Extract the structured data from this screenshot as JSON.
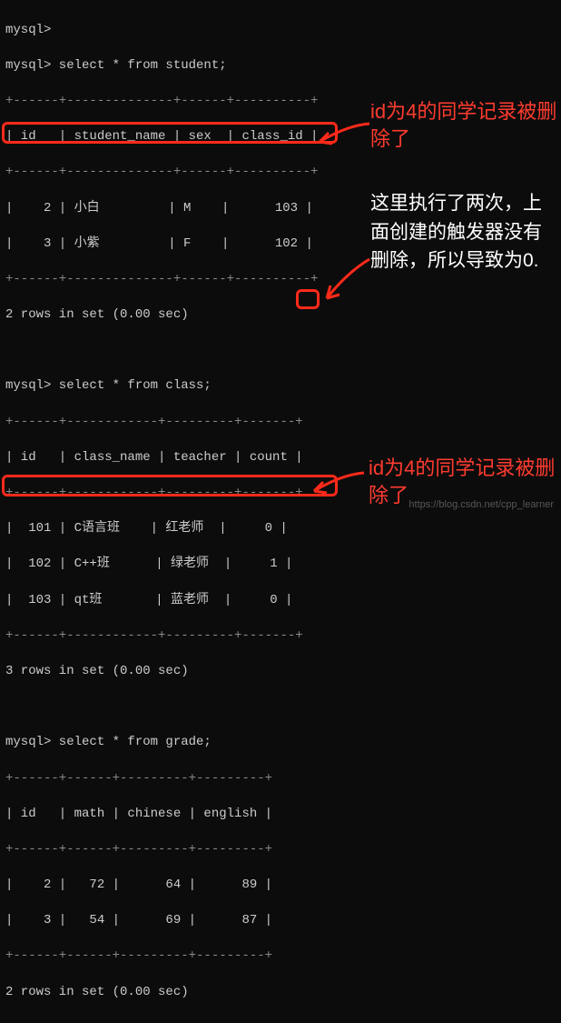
{
  "prompts": {
    "p0": "mysql>",
    "p1": "mysql> select * from student;",
    "p2": "mysql> select * from class;",
    "p3": "mysql> select * from grade;"
  },
  "student": {
    "sep": "+------+--------------+------+----------+",
    "header": "| id   | student_name | sex  | class_id |",
    "rows": [
      "|    2 | 小白         | M    |      103 |",
      "|    3 | 小紫         | F    |      102 |"
    ],
    "footer": "2 rows in set (0.00 sec)"
  },
  "class": {
    "sep": "+------+------------+---------+-------+",
    "header": "| id   | class_name | teacher | count |",
    "rows": [
      "|  101 | C语言班    | 红老师  |     0 |",
      "|  102 | C++班      | 绿老师  |     1 |",
      "|  103 | qt班       | 蓝老师  |     0 |"
    ],
    "footer": "3 rows in set (0.00 sec)"
  },
  "grade": {
    "sep": "+------+------+---------+---------+",
    "header": "| id   | math | chinese | english |",
    "rows": [
      "|    2 |   72 |      64 |      89 |",
      "|    3 |   54 |      69 |      87 |"
    ],
    "footer": "2 rows in set (0.00 sec)"
  },
  "annotations": {
    "a1": "id为4的同学记录被删除了",
    "a2": "这里执行了两次，上面创建的触发器没有删除，所以导致为0.",
    "a3": "id为4的同学记录被删除了"
  },
  "watermark": "https://blog.csdn.net/cpp_learner"
}
